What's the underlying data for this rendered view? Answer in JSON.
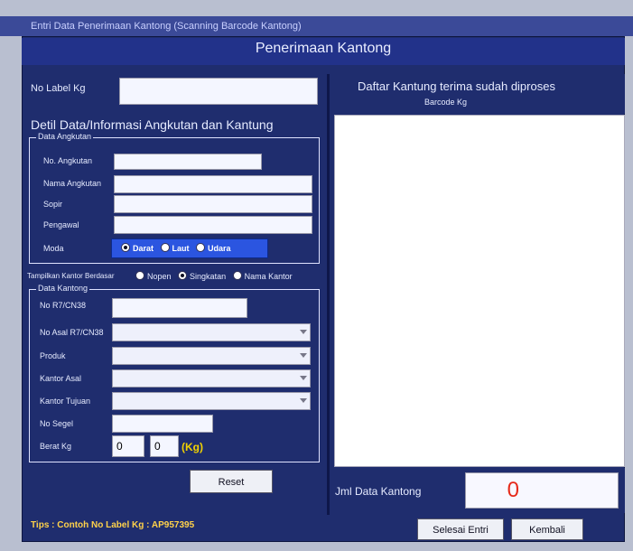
{
  "window": {
    "title": "Entri Data Penerimaan Kantong (Scanning Barcode Kantong)"
  },
  "header": {
    "title": "Penerimaan Kantong"
  },
  "left": {
    "no_label_kg": {
      "label": "No Label Kg",
      "value": ""
    },
    "detail_title": "Detil Data/Informasi Angkutan dan Kantung",
    "data_angkutan": {
      "group_label": "Data Angkutan",
      "fields": [
        {
          "label": "No. Angkutan",
          "value": ""
        },
        {
          "label": "Nama Angkutan",
          "value": ""
        },
        {
          "label": "Sopir",
          "value": ""
        },
        {
          "label": "Pengawal",
          "value": ""
        }
      ],
      "moda": {
        "label": "Moda",
        "options": [
          "Darat",
          "Laut",
          "Udara"
        ],
        "selected": "Darat"
      }
    },
    "tampilkan_kantor": {
      "label": "Tampilkan Kantor Berdasar",
      "options": [
        "Nopen",
        "Singkatan",
        "Nama Kantor"
      ],
      "selected": "Singkatan"
    },
    "data_kantong": {
      "group_label": "Data Kantong",
      "no_r7": {
        "label": "No R7/CN38",
        "value": ""
      },
      "no_asal": {
        "label": "No Asal R7/CN38",
        "value": ""
      },
      "produk": {
        "label": "Produk",
        "value": ""
      },
      "kantor_asal": {
        "label": "Kantor Asal",
        "value": ""
      },
      "kantor_tujuan": {
        "label": "Kantor Tujuan",
        "value": ""
      },
      "no_segel": {
        "label": "No Segel",
        "value": ""
      },
      "berat": {
        "label": "Berat Kg",
        "value1": "0",
        "value2": "0",
        "unit": "(Kg)"
      }
    },
    "reset_button": "Reset"
  },
  "right": {
    "list_title": "Daftar Kantung terima sudah diproses",
    "list_column": "Barcode Kg",
    "list_items": [],
    "count_label": "Jml Data Kantong",
    "count_value": "0"
  },
  "footer": {
    "tips": "Tips : Contoh No Label Kg : AP957395",
    "buttons": {
      "selesai": "Selesai Entri",
      "kembali": "Kembali"
    }
  },
  "colors": {
    "panel_bg": "#1f2d6e",
    "header_bg": "#22328a",
    "mode_strip_bg": "#2b55e0",
    "count_text": "#e62a1a",
    "tips_text": "#ffd24a",
    "kg_text": "#f2d200"
  }
}
